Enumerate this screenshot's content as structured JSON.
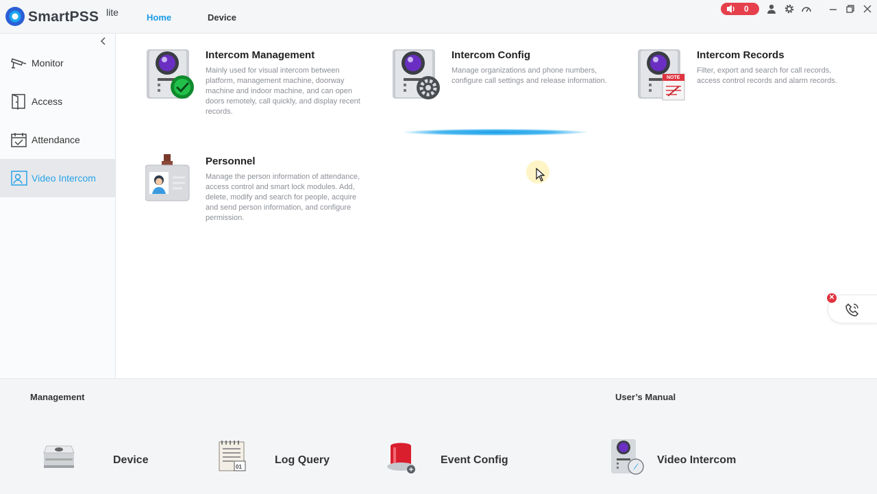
{
  "app": {
    "name": "SmartPSS",
    "edition": "lite"
  },
  "nav": {
    "home": "Home",
    "device": "Device"
  },
  "alarm": {
    "count": "0"
  },
  "colors": {
    "accent": "#1a9be6",
    "alarm": "#e5404c",
    "sidebar_active_text": "#29a3e6"
  },
  "sidebar": {
    "items": [
      {
        "label": "Monitor",
        "icon": "cctv-camera-icon"
      },
      {
        "label": "Access",
        "icon": "door-icon"
      },
      {
        "label": "Attendance",
        "icon": "calendar-check-icon"
      },
      {
        "label": "Video Intercom",
        "icon": "intercom-person-icon",
        "active": true
      }
    ]
  },
  "modules": [
    {
      "title": "Intercom Management",
      "description": "Mainly used for visual intercom between platform, management machine, doorway machine and indoor machine, and can open doors remotely, call quickly, and display recent records."
    },
    {
      "title": "Intercom Config",
      "description": "Manage organizations and phone numbers, configure call settings and release information."
    },
    {
      "title": "Intercom Records",
      "description": "Filter, export and search for call records, access control records and alarm records."
    },
    {
      "title": "Personnel",
      "description": "Manage the person information of attendance, access control and smart lock modules. Add, delete, modify and search for people, acquire and send person information, and configure permission."
    }
  ],
  "records_icon_text": "NOTE",
  "bottom": {
    "management_label": "Management",
    "manual_label": "User’s Manual",
    "management_items": [
      {
        "label": "Device",
        "icon": "device-box-icon"
      },
      {
        "label": "Log Query",
        "icon": "log-calendar-icon"
      },
      {
        "label": "Event Config",
        "icon": "alarm-siren-icon"
      }
    ],
    "manual_items": [
      {
        "label": "Video Intercom",
        "icon": "intercom-compass-icon"
      }
    ]
  }
}
